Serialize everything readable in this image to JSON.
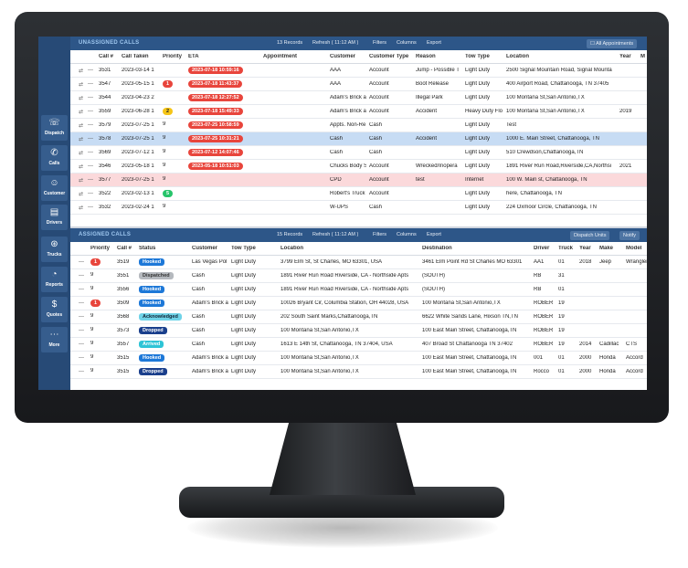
{
  "sidebar": [
    {
      "label": "Dispatch",
      "icon": "headset-icon",
      "glyph": "☏"
    },
    {
      "label": "Calls",
      "icon": "phone-icon",
      "glyph": "✆"
    },
    {
      "label": "Customer",
      "icon": "customer-icon",
      "glyph": "☺"
    },
    {
      "label": "Drivers",
      "icon": "id-card-icon",
      "glyph": "▤"
    },
    {
      "label": "Trucks",
      "icon": "steering-wheel-icon",
      "glyph": "⊛"
    },
    {
      "label": "Reports",
      "icon": "pie-chart-icon",
      "glyph": "◔"
    },
    {
      "label": "Quotes",
      "icon": "dollar-icon",
      "glyph": "$"
    },
    {
      "label": "More",
      "icon": "more-icon",
      "glyph": "⋯"
    }
  ],
  "unassigned": {
    "title": "UNASSIGNED CALLS",
    "records": "13 Records",
    "refresh": "Refresh ( 11:12 AM )",
    "filters": "Filters",
    "columns": "Columns",
    "export": "Export",
    "all_appointments": "All Appointments",
    "headers": [
      "Call #",
      "Call Taken",
      "Priority",
      "ETA",
      "Appointment",
      "Customer",
      "Customer Type",
      "Reason",
      "Tow Type",
      "Location",
      "Year",
      "M"
    ],
    "rows": [
      {
        "call": "3531",
        "taken": "2023-03-14 1",
        "priority": "",
        "eta": "2023-07-18 10:59:16",
        "appt": "",
        "customer": "AAA",
        "ctype": "Account",
        "reason": "Jump - Possible T",
        "tow": "Light Duty",
        "location": "2500 Signal Mountain Road, Signal Mounta",
        "year": ""
      },
      {
        "call": "3547",
        "taken": "2023-05-15 1",
        "priority": "1",
        "eta": "2023-07-18 11:43:37",
        "appt": "",
        "customer": "AAA",
        "ctype": "Account",
        "reason": "Boot Release",
        "tow": "Light Duty",
        "location": "400 Airport Road, Chattanooga, TN 37405",
        "year": ""
      },
      {
        "call": "3544",
        "taken": "2023-04-23 2",
        "priority": "",
        "eta": "2023-07-18 12:27:52",
        "appt": "",
        "customer": "Adam's Brick a",
        "ctype": "Account",
        "reason": "Illegal Park",
        "tow": "Light Duty",
        "location": "100 Montana St,San Antonio,TX",
        "year": ""
      },
      {
        "call": "3559",
        "taken": "2023-06-28 1",
        "priority": "2",
        "eta": "2023-07-18 15:49:33",
        "appt": "",
        "customer": "Adam's Brick a",
        "ctype": "Account",
        "reason": "Accident",
        "tow": "Heavy Duty Flo",
        "location": "100 Montana St,San Antonio,TX",
        "year": "2019"
      },
      {
        "call": "3579",
        "taken": "2023-07-25 1",
        "priority": "9",
        "eta": "2023-07-25 10:58:59",
        "appt": "",
        "customer": "Appts. Non-Re",
        "ctype": "Cash",
        "reason": "",
        "tow": "Light Duty",
        "location": "Test",
        "year": ""
      },
      {
        "call": "3578",
        "taken": "2023-07-25 1",
        "priority": "9",
        "eta": "2023-07-25 10:31:21",
        "appt": "",
        "customer": "Cash",
        "ctype": "Cash",
        "reason": "Accident",
        "tow": "Light Duty",
        "location": "1000 E. Main Street, Chattanooga, TN",
        "year": ""
      },
      {
        "call": "3569",
        "taken": "2023-07-12 1",
        "priority": "9",
        "eta": "2023-07-12 14:07:46",
        "appt": "",
        "customer": "Cash",
        "ctype": "Cash",
        "reason": "",
        "tow": "Light Duty",
        "location": "510 Crewdson,Chattanooga,TN",
        "year": ""
      },
      {
        "call": "3546",
        "taken": "2023-05-18 1",
        "priority": "9",
        "eta": "2023-05-18 10:51:03",
        "appt": "",
        "customer": "Chucks Body S",
        "ctype": "Account",
        "reason": "Wrecked/Inopera",
        "tow": "Light Duty",
        "location": "1891 River Run Road,Riverside,CA,Northsi",
        "year": "2021"
      },
      {
        "call": "3577",
        "taken": "2023-07-25 1",
        "priority": "9",
        "eta": "",
        "appt": "",
        "customer": "CPD",
        "ctype": "Account",
        "reason": "test",
        "tow": "Internet",
        "location": "100 W. Main st, Chattanooga, TN",
        "year": ""
      },
      {
        "call": "3522",
        "taken": "2023-02-13 1",
        "priority": "5",
        "eta": "",
        "appt": "",
        "customer": "Robert's Truck",
        "ctype": "Account",
        "reason": "",
        "tow": "Light Duty",
        "location": "here, Chattanooga, TN",
        "year": ""
      },
      {
        "call": "3532",
        "taken": "2023-02-24 1",
        "priority": "9",
        "eta": "",
        "appt": "",
        "customer": "W-UPS",
        "ctype": "Cash",
        "reason": "",
        "tow": "Light Duty",
        "location": "224 Oxmoor Circle, Chattanooga, TN",
        "year": ""
      }
    ]
  },
  "assigned": {
    "title": "ASSIGNED CALLS",
    "records": "15 Records",
    "refresh": "Refresh ( 11:12 AM )",
    "filters": "Filters",
    "columns": "Columns",
    "export": "Export",
    "dispatch_units": "Dispatch Units",
    "notify": "Notify",
    "headers": [
      "Priority",
      "Call #",
      "Status",
      "Customer",
      "Tow Type",
      "Location",
      "Destination",
      "Driver",
      "Truck",
      "Year",
      "Make",
      "Model"
    ],
    "rows": [
      {
        "priority": "1",
        "call": "3519",
        "status": "Hooked",
        "customer": "Las Vegas Pol",
        "tow": "Light Duty",
        "location": "3799 Elm St, St Charles, MO 63301, USA",
        "dest": "3461 Elm Point Rd St Charles MO 63301",
        "driver": "AA1",
        "truck": "01",
        "year": "2018",
        "make": "Jeep",
        "model": "Wrangler"
      },
      {
        "priority": "9",
        "call": "3551",
        "status": "Dispatched",
        "customer": "Cash",
        "tow": "Light Duty",
        "location": "1891 River Run Road Riverside, CA - Northside Apts",
        "dest": "(SOUTH)",
        "driver": "RB",
        "truck": "31",
        "year": "",
        "make": "",
        "model": ""
      },
      {
        "priority": "9",
        "call": "3556",
        "status": "Hooked",
        "customer": "Cash",
        "tow": "Light Duty",
        "location": "1891 River Run Road Riverside, CA - Northside Apts",
        "dest": "(SOUTH)",
        "driver": "RB",
        "truck": "01",
        "year": "",
        "make": "",
        "model": ""
      },
      {
        "priority": "1",
        "call": "3509",
        "status": "Hooked",
        "customer": "Adam's Brick a",
        "tow": "Light Duty",
        "location": "10026 Bryant Cir, Columbia Station, OH 44028, USA",
        "dest": "100 Montana St,San Antonio,TX",
        "driver": "ROBER",
        "truck": "19",
        "year": "",
        "make": "",
        "model": ""
      },
      {
        "priority": "9",
        "call": "3568",
        "status": "Acknowledged",
        "customer": "Cash",
        "tow": "Light Duty",
        "location": "202 South Saint Marks,Chattanooga,TN",
        "dest": "6622 White Sands Lane, Hixson TN,TN",
        "driver": "ROBER",
        "truck": "19",
        "year": "",
        "make": "",
        "model": ""
      },
      {
        "priority": "9",
        "call": "3573",
        "status": "Dropped",
        "customer": "Cash",
        "tow": "Light Duty",
        "location": "100 Montana St,San Antonio,TX",
        "dest": "100 East Main Street, Chattanooga,TN",
        "driver": "ROBER",
        "truck": "19",
        "year": "",
        "make": "",
        "model": ""
      },
      {
        "priority": "9",
        "call": "3557",
        "status": "Arrived",
        "customer": "Cash",
        "tow": "Light Duty",
        "location": "1613 E 14th St, Chattanooga, TN 37404, USA",
        "dest": "407 Broad St Chattanooga TN 37402",
        "driver": "ROBER",
        "truck": "19",
        "year": "2014",
        "make": "Cadillac",
        "model": "CTS"
      },
      {
        "priority": "9",
        "call": "3515",
        "status": "Hooked",
        "customer": "Adam's Brick a",
        "tow": "Light Duty",
        "location": "100 Montana St,San Antonio,TX",
        "dest": "100 East Main Street, Chattanooga,TN",
        "driver": "001",
        "truck": "01",
        "year": "2000",
        "make": "Honda",
        "model": "Accord"
      },
      {
        "priority": "9",
        "call": "3515",
        "status": "Dropped",
        "customer": "Adam's Brick a",
        "tow": "Light Duty",
        "location": "100 Montana St,San Antonio,TX",
        "dest": "100 East Main Street, Chattanooga,TN",
        "driver": "Rocco",
        "truck": "01",
        "year": "2000",
        "make": "Honda",
        "model": "Accord"
      }
    ]
  },
  "colors": {
    "sidebar": "#274a76",
    "header": "#2d5688",
    "eta": "#e8453c",
    "selected_row": "#c7dcf4",
    "alert_row": "#fbd9db",
    "status_hooked": "#1d78d8",
    "status_dispatched": "#b5b9be",
    "status_acknowledged": "#6fd3e8",
    "status_dropped": "#1a3f8c",
    "status_arrived": "#2ec4d6"
  }
}
